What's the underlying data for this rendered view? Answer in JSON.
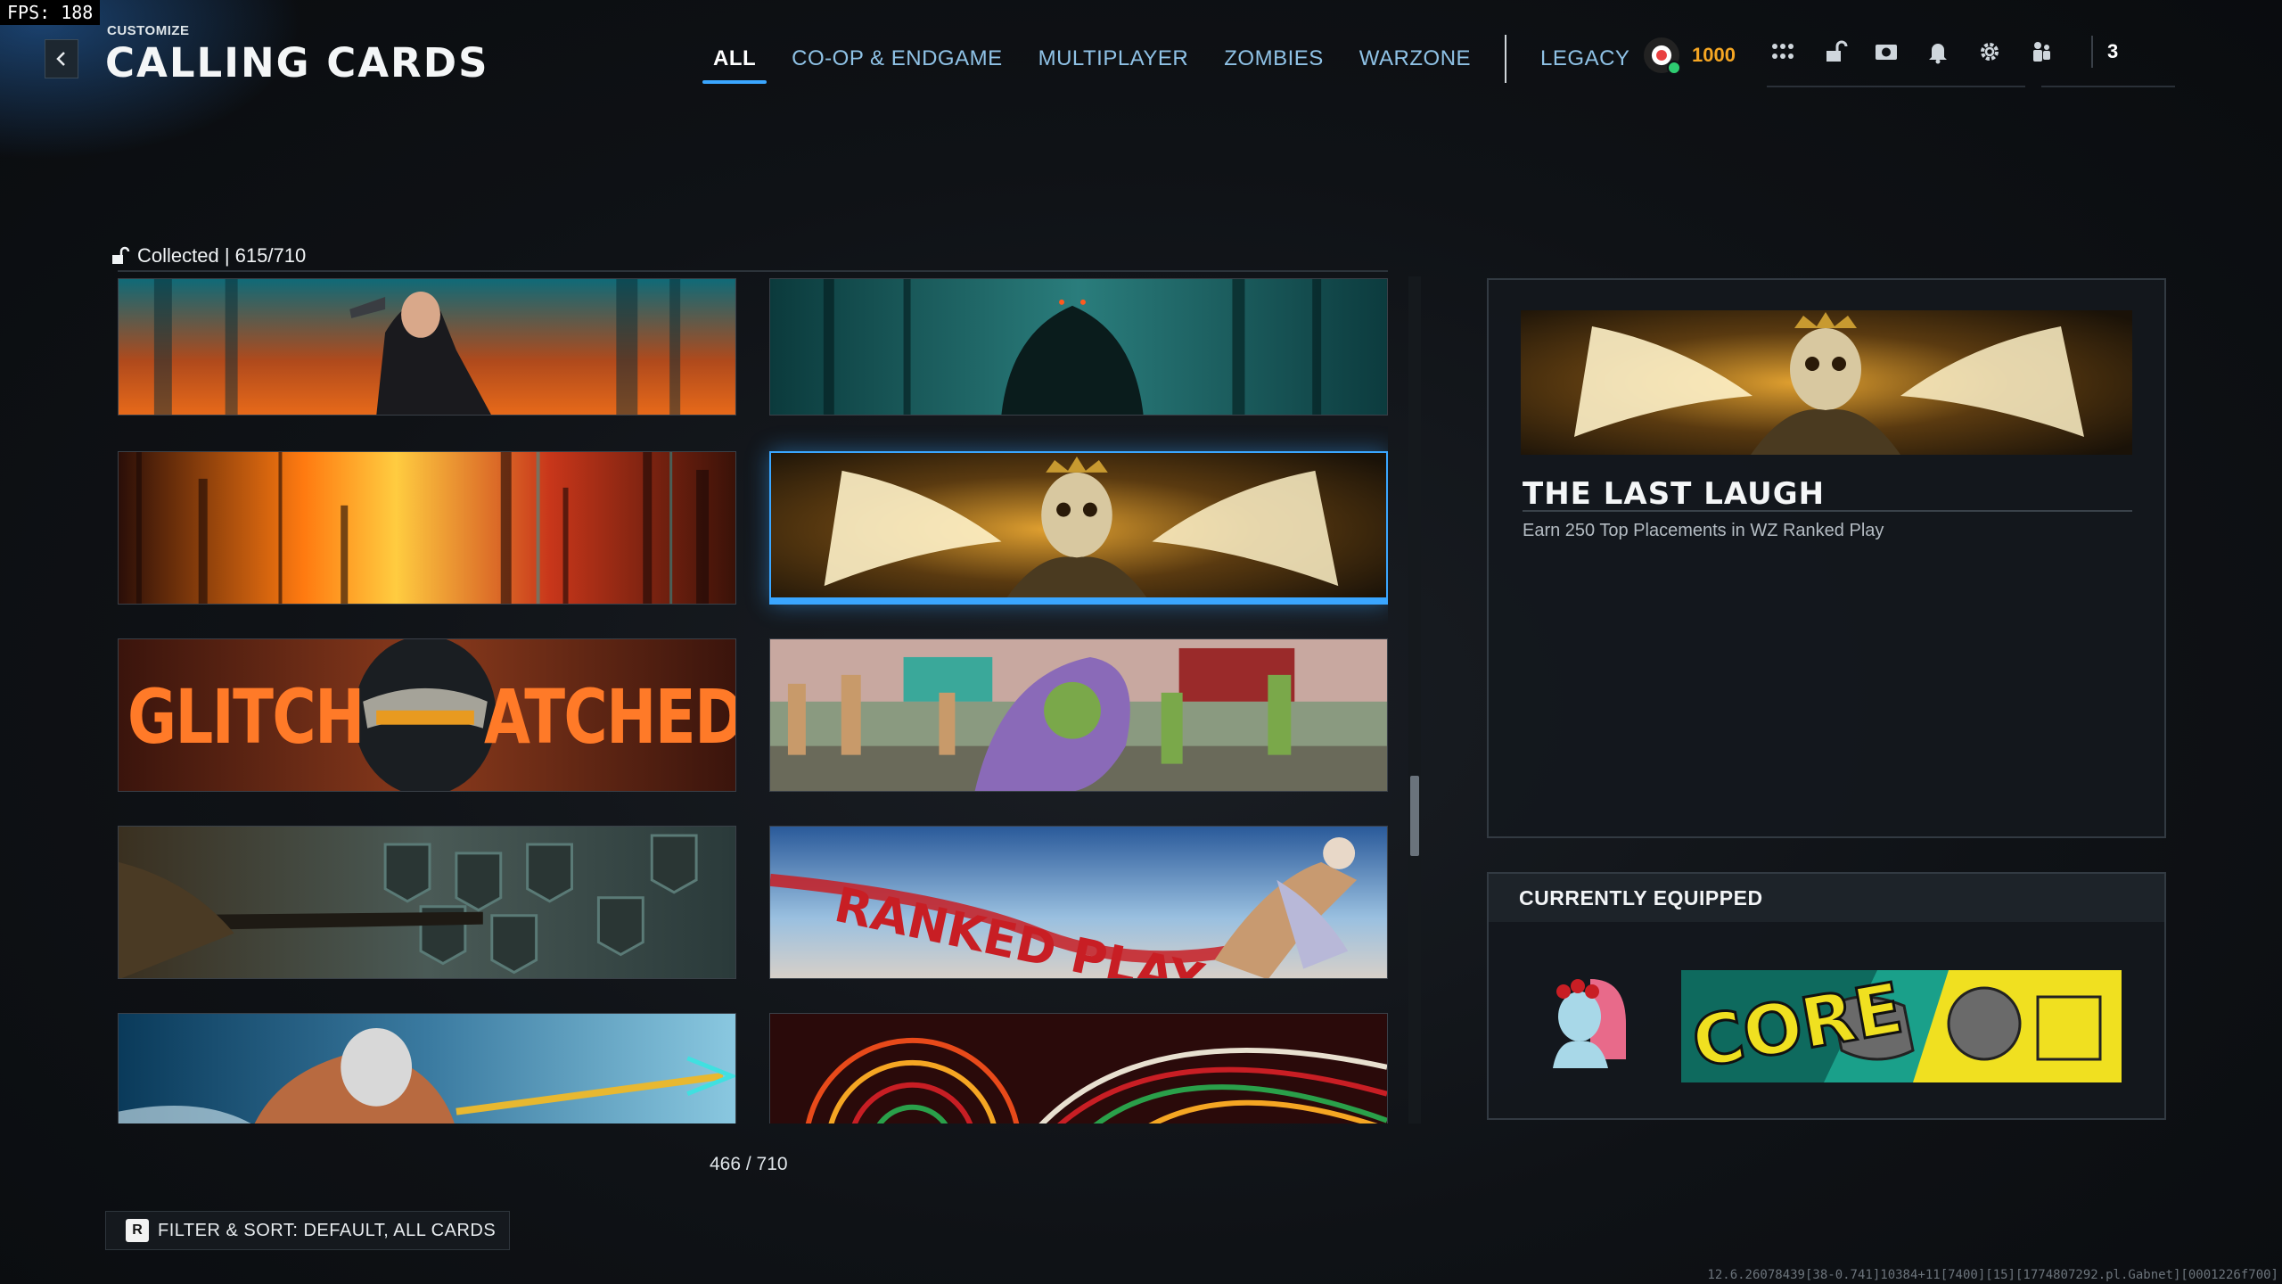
{
  "fps": "FPS: 188",
  "header": {
    "subtitle": "CUSTOMIZE",
    "title": "CALLING CARDS"
  },
  "tabs": [
    {
      "label": "ALL",
      "active": true
    },
    {
      "label": "CO-OP & ENDGAME"
    },
    {
      "label": "MULTIPLAYER"
    },
    {
      "label": "ZOMBIES"
    },
    {
      "label": "WARZONE"
    },
    {
      "label": "LEGACY"
    }
  ],
  "currency": {
    "value": "1000",
    "color": "#f5a623"
  },
  "topbar_icons": [
    "apps-grid-icon",
    "padlock-icon",
    "camera-icon",
    "bell-icon",
    "gear-icon",
    "party-icon"
  ],
  "party_count": "3",
  "collection": {
    "label": "Collected | 615/710"
  },
  "cards": [
    {
      "id": "agent-operator",
      "selected": false
    },
    {
      "id": "jungle-beast",
      "selected": false
    },
    {
      "id": "orange-glitch",
      "selected": false
    },
    {
      "id": "the-last-laugh",
      "selected": true
    },
    {
      "id": "glitch-patched",
      "text_left": "GLITCH",
      "text_right": "ATCHED",
      "selected": false
    },
    {
      "id": "zombie-barbecue",
      "selected": false
    },
    {
      "id": "sniper-helmets",
      "selected": false
    },
    {
      "id": "ranked-play",
      "text": "RANKED PLAY",
      "selected": false
    },
    {
      "id": "poseidon",
      "selected": false
    },
    {
      "id": "spiral-pattern",
      "selected": false
    }
  ],
  "pagination": {
    "label": "466 / 710"
  },
  "filter": {
    "key": "R",
    "label": "FILTER & SORT: DEFAULT, ALL CARDS"
  },
  "detail": {
    "name": "THE LAST LAUGH",
    "description": "Earn 250 Top Placements in WZ Ranked Play"
  },
  "equipped": {
    "label": "CURRENTLY EQUIPPED",
    "card_text": "CORE"
  },
  "debug_string": "12.6.26078439[38-0.741]10384+11[7400][15][1774807292.pl.Gabnet][0001226f700]",
  "accent_color": "#3aa6ff"
}
